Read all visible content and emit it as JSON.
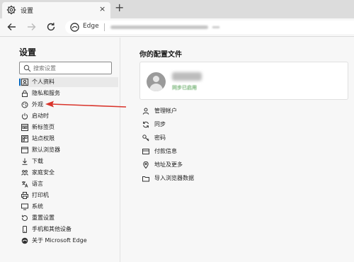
{
  "tab": {
    "title": "设置",
    "close": "×",
    "new": "+"
  },
  "address": {
    "browser_label": "Edge"
  },
  "sidebar": {
    "title": "设置",
    "search_placeholder": "搜索设置",
    "items": [
      {
        "label": "个人资料",
        "icon": "profile-icon",
        "active": true
      },
      {
        "label": "隐私和服务",
        "icon": "lock-icon"
      },
      {
        "label": "外观",
        "icon": "appearance-icon"
      },
      {
        "label": "启动时",
        "icon": "power-icon"
      },
      {
        "label": "新标签页",
        "icon": "new-tab-icon"
      },
      {
        "label": "站点权限",
        "icon": "site-permissions-icon"
      },
      {
        "label": "默认浏览器",
        "icon": "default-browser-icon"
      },
      {
        "label": "下载",
        "icon": "download-icon"
      },
      {
        "label": "家庭安全",
        "icon": "family-icon"
      },
      {
        "label": "语言",
        "icon": "language-icon"
      },
      {
        "label": "打印机",
        "icon": "printer-icon"
      },
      {
        "label": "系统",
        "icon": "system-icon"
      },
      {
        "label": "重置设置",
        "icon": "reset-icon"
      },
      {
        "label": "手机和其他设备",
        "icon": "phone-icon"
      },
      {
        "label": "关于 Microsoft Edge",
        "icon": "edge-icon"
      }
    ]
  },
  "main": {
    "title": "你的配置文件",
    "profile": {
      "sync_status": "同步已启用"
    },
    "menu": [
      {
        "label": "管理帐户",
        "icon": "person-icon"
      },
      {
        "label": "同步",
        "icon": "sync-icon"
      },
      {
        "label": "密码",
        "icon": "key-icon"
      },
      {
        "label": "付款信息",
        "icon": "card-icon"
      },
      {
        "label": "地址及更多",
        "icon": "location-icon"
      },
      {
        "label": "导入浏览器数据",
        "icon": "import-icon"
      }
    ]
  },
  "colors": {
    "accent": "#0067c0",
    "arrow": "#d9342b",
    "sync_green": "#2e8b2e"
  }
}
